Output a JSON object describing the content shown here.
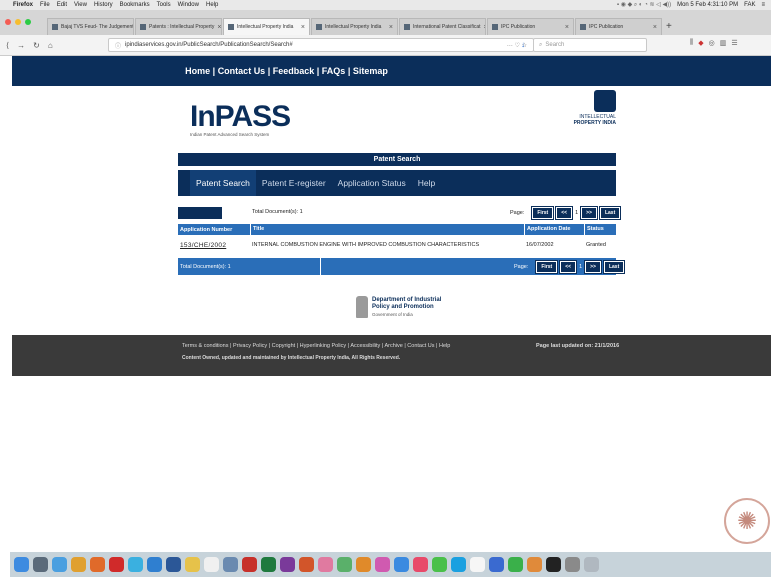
{
  "os": {
    "apple": "",
    "menu": [
      "Firefox",
      "File",
      "Edit",
      "View",
      "History",
      "Bookmarks",
      "Tools",
      "Window",
      "Help"
    ],
    "clock": "Mon 5 Feb 4:31:10 PM",
    "user": "FAK"
  },
  "browser": {
    "tabs": [
      {
        "label": "Bajaj TVS Feud- The Judgement"
      },
      {
        "label": "Patents : Intellectual Property"
      },
      {
        "label": "Intellectual Property India"
      },
      {
        "label": "Intellectual Property India"
      },
      {
        "label": "International Patent Classificat"
      },
      {
        "label": "IPC Publication"
      },
      {
        "label": "IPC Publication"
      }
    ],
    "url": "ipindiaservices.gov.in/PublicSearch/PublicationSearch/Search#",
    "search_placeholder": "Search"
  },
  "site": {
    "top_links": [
      "Home",
      "Contact Us",
      "Feedback",
      "FAQs",
      "Sitemap"
    ],
    "logo_text": "InPASS",
    "logo_sub": "Indian Patent Advanced Search System",
    "ip_logo_l1": "INTELLECTUAL",
    "ip_logo_l2": "PROPERTY INDIA",
    "section_title": "Patent Search",
    "tabs": [
      "Patent Search",
      "Patent E-register",
      "Application Status",
      "Help"
    ],
    "total_docs": "Total Document(s): 1",
    "total_docs_footer": "Total Document(s): 1",
    "page_label": "Page:",
    "pager": {
      "first": "First",
      "prev": "<<",
      "num": "1",
      "next": ">>",
      "last": "Last"
    },
    "table": {
      "headers": [
        "Application Number",
        "Title",
        "Application Date",
        "Status"
      ],
      "rows": [
        {
          "app_no": "153/CHE/2002",
          "title": "INTERNAL COMBUSTION ENGINE WITH IMPROVED COMBUSTION CHARACTERISTICS",
          "date": "16/07/2002",
          "status": "Granted"
        }
      ]
    },
    "dept_l1": "Department of Industrial",
    "dept_l2": "Policy and Promotion",
    "dept_l3": "Government of India",
    "footer_links": "Terms & conditions | Privacy Policy | Copyright | Hyperlinking Policy | Accessibility | Archive | Contact Us | Help",
    "footer_copy": "Content Owned, updated and maintained by Intellectual Property India, All Rights Reserved.",
    "footer_updated": "Page last updated on: 21/1/2016"
  },
  "colors": {
    "navy": "#0b2e5a",
    "header_blue": "#2a6eb8",
    "footer": "#3a3a3a"
  }
}
